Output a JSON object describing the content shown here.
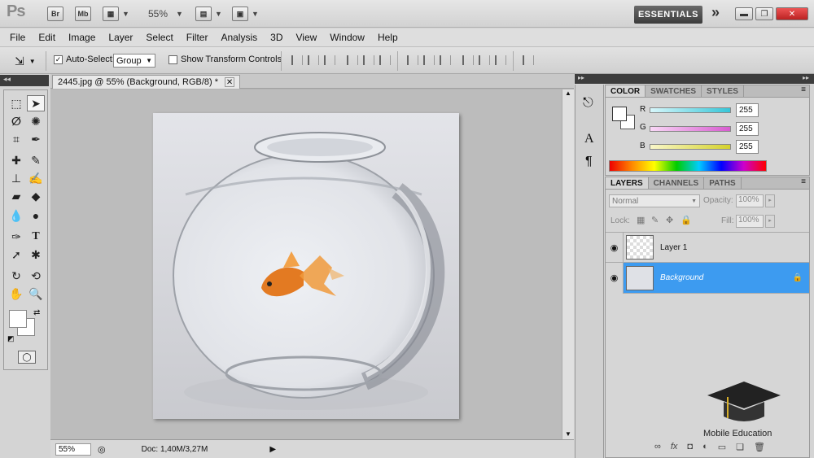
{
  "appbar": {
    "logo": "Ps",
    "bridge_label": "Br",
    "minibridge_label": "Mb",
    "zoom": "55%",
    "workspace": "ESSENTIALS",
    "more": "»"
  },
  "menu": [
    "File",
    "Edit",
    "Image",
    "Layer",
    "Select",
    "Filter",
    "Analysis",
    "3D",
    "View",
    "Window",
    "Help"
  ],
  "options": {
    "auto_select_label": "Auto-Select:",
    "auto_select_value": "Group",
    "show_transform_label": "Show Transform Controls"
  },
  "document": {
    "tab_title": "2445.jpg @ 55% (Background, RGB/8) *",
    "zoom": "55%",
    "doc_info": "Doc: 1,40M/3,27M"
  },
  "color_panel": {
    "tabs": [
      "COLOR",
      "SWATCHES",
      "STYLES"
    ],
    "channels": [
      {
        "label": "R",
        "value": "255",
        "color": "#36c6d8"
      },
      {
        "label": "G",
        "value": "255",
        "color": "#d85cd0"
      },
      {
        "label": "B",
        "value": "255",
        "color": "#d4d12c"
      }
    ]
  },
  "layers_panel": {
    "tabs": [
      "LAYERS",
      "CHANNELS",
      "PATHS"
    ],
    "blend_mode": "Normal",
    "opacity_label": "Opacity:",
    "opacity_value": "100%",
    "lock_label": "Lock:",
    "fill_label": "Fill:",
    "fill_value": "100%",
    "layers": [
      {
        "name": "Layer 1",
        "selected": false
      },
      {
        "name": "Background",
        "selected": true
      }
    ]
  },
  "watermark": {
    "text": "Mobile Education"
  },
  "colors": {
    "selection_blue": "#3d9bf0",
    "panel_bg": "#d6d6d6"
  }
}
